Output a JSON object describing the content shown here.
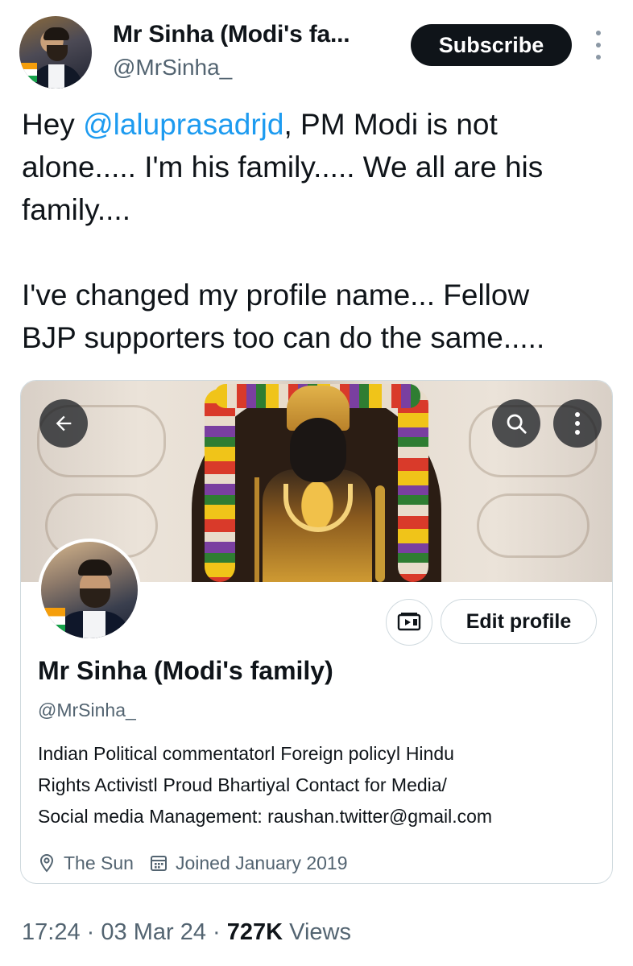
{
  "tweet": {
    "author": {
      "display_name": "Mr Sinha (Modi's fa...",
      "handle": "@MrSinha_"
    },
    "subscribe_label": "Subscribe",
    "text": {
      "line1_prefix": "Hey ",
      "mention": "@laluprasadrjd",
      "line1_suffix": ", PM Modi is not",
      "line2": "alone..... I'm his family..... We all are his",
      "line3": "family....",
      "line4": "I've changed my profile name... Fellow",
      "line5": "BJP supporters too can do the same....."
    },
    "footer": {
      "time": "17:24",
      "separator": "·",
      "date": "03 Mar 24",
      "views_count": "727K",
      "views_label": "Views"
    }
  },
  "profile_card": {
    "edit_profile_label": "Edit profile",
    "name": "Mr Sinha (Modi's family)",
    "handle": "@MrSinha_",
    "bio": [
      "Indian Political commentatorǀ Foreign policyǀ Hindu",
      "Rights Activistǀ Proud Bhartiyaǀ  Contact for Media/",
      "Social media Management: raushan.twitter@gmail.com"
    ],
    "location": "The Sun",
    "joined": "Joined January 2019",
    "icons": {
      "back": "arrow-left-icon",
      "search": "search-icon",
      "more": "more-vertical-icon",
      "media": "media-icon",
      "location": "location-pin-icon",
      "calendar": "calendar-icon"
    }
  },
  "colors": {
    "text": "#0f1419",
    "secondary": "#536471",
    "mention": "#1d9bf0",
    "border": "#cfd9de",
    "subscribe_bg": "#0f1419"
  }
}
